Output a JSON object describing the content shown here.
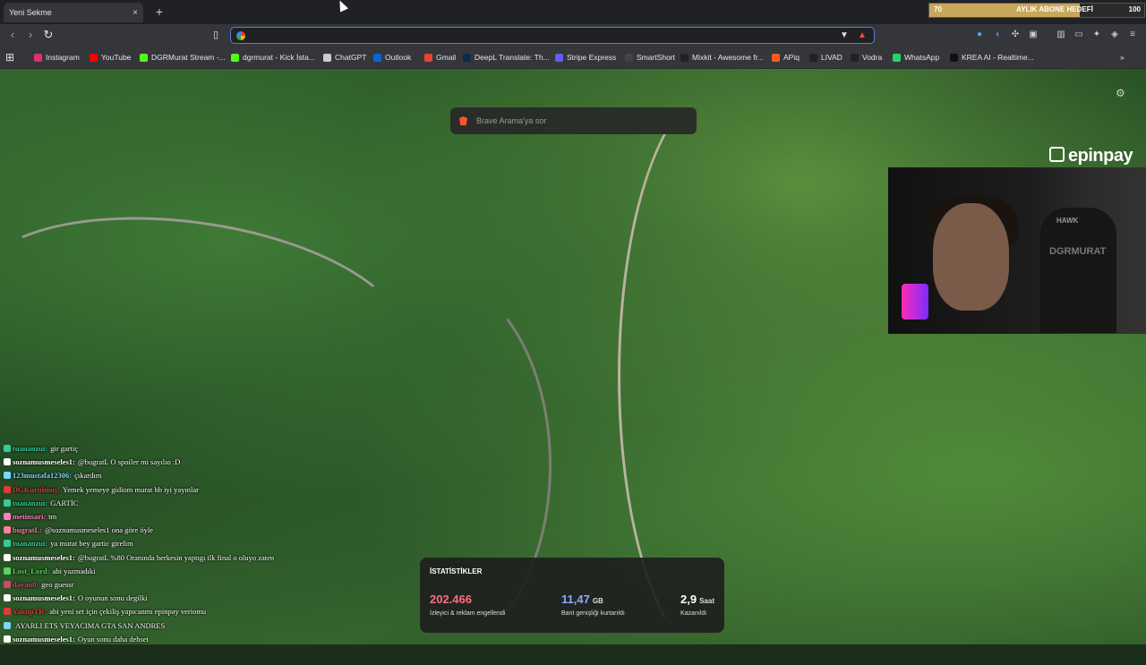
{
  "window": {
    "tab_title": "Yeni Sekme",
    "tab_close": "×",
    "new_tab": "+"
  },
  "goal": {
    "current": "70",
    "label": "AYLIK ABONE HEDEFİ",
    "target": "100",
    "progress": 0.7
  },
  "toolbar": {
    "back": "‹",
    "forward": "›",
    "reload": "↻",
    "address_value": "",
    "address_placeholder": ""
  },
  "bookmarks": [
    {
      "label": "Instagram",
      "color": "#e1306c"
    },
    {
      "label": "YouTube",
      "color": "#ff0000"
    },
    {
      "label": "DGRMurat Stream -...",
      "color": "#53fc18"
    },
    {
      "label": "dgrmurat - Kick İsta...",
      "color": "#53fc18"
    },
    {
      "label": "ChatGPT",
      "color": "#cccccc"
    },
    {
      "label": "Outlook",
      "color": "#0a64d8"
    },
    {
      "label": "Gmail",
      "color": "#ea4335"
    },
    {
      "label": "DeepL Translate: Th...",
      "color": "#0f2b46"
    },
    {
      "label": "Stripe Express",
      "color": "#635bff"
    },
    {
      "label": "SmartShort",
      "color": "#444444"
    },
    {
      "label": "Mixkit - Awesome fr...",
      "color": "#222222"
    },
    {
      "label": "APiq",
      "color": "#ff5a1f"
    },
    {
      "label": "LIVAD",
      "color": "#222222"
    },
    {
      "label": "Vodra",
      "color": "#222222"
    },
    {
      "label": "WhatsApp",
      "color": "#25d366"
    },
    {
      "label": "KREA AI - Realtime...",
      "color": "#111111"
    }
  ],
  "brave_search": {
    "placeholder": "Brave Arama'ya sor"
  },
  "sponsor": {
    "name": "epinpay"
  },
  "webcam": {
    "brand_top": "HAWK",
    "brand_chair": "DGRMURAT"
  },
  "chat": [
    {
      "user": "tuananzui:",
      "text": "gir gartiç",
      "color": "#3ac99c"
    },
    {
      "user": "soznamusmeseles1:",
      "text": "@bugratL O spoiler mi sayılıo :D",
      "color": "#ffffff"
    },
    {
      "user": "123mustafa12306:",
      "text": "çıkardım",
      "color": "#7cd7ff"
    },
    {
      "user": "DGKurulmuş:",
      "text": "Yemek yemeye gidiom murat bb iyi yayınlar",
      "color": "#e03a3a"
    },
    {
      "user": "tuananzui:",
      "text": "GARTİC",
      "color": "#3ac99c"
    },
    {
      "user": "metinsari:",
      "text": "tm",
      "color": "#ff7fbf"
    },
    {
      "user": "bugratL:",
      "text": "@soznamusmeseles1 ona göre öyle",
      "color": "#ff7f9f"
    },
    {
      "user": "tuananzui:",
      "text": "ya murat bey gartic girelim",
      "color": "#3ac99c"
    },
    {
      "user": "soznamusmeseles1:",
      "text": "@bugratL %80 Oranında herkesin yaptıgı ilk final o oluyo zaten",
      "color": "#ffffff"
    },
    {
      "user": "Lost_Lord:",
      "text": "abi yazmadıki",
      "color": "#5fd35f"
    },
    {
      "user": "dayan0:",
      "text": "geo guessr",
      "color": "#d04a6a"
    },
    {
      "user": "soznamusmeseles1:",
      "text": "O oyunun sonu degilki",
      "color": "#ffffff"
    },
    {
      "user": "YakupTR:",
      "text": "abi yeni set için çekiliş yapıcanmı epinpay veriomu",
      "color": "#e03a3a"
    },
    {
      "user": "",
      "text": "AYARLI ETS VEYACIMA GTA SAN ANDRES",
      "color": "#7cd7ff"
    },
    {
      "user": "soznamusmeseles1:",
      "text": "Oyun sonu daha dehset",
      "color": "#ffffff"
    }
  ],
  "stats": {
    "title": "İSTATİSTİKLER",
    "items": [
      {
        "value": "202.466",
        "unit": "",
        "desc": "İzleyici & reklam engellendi",
        "color": "#ff6b81"
      },
      {
        "value": "11,47",
        "unit": "GB",
        "desc": "Bant genişliği kurtarıldı",
        "color": "#8fa8ff"
      },
      {
        "value": "2,9",
        "unit": "Saat",
        "desc": "Kazanıldı",
        "color": "#ffffff"
      }
    ]
  }
}
